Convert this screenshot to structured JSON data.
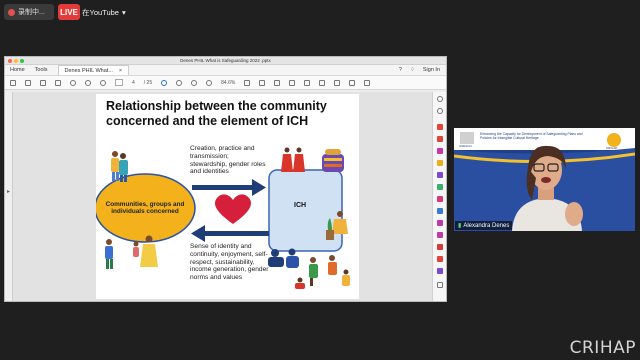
{
  "meeting": {
    "recording_label": "录制中...",
    "live_badge": "LIVE",
    "stream_target": "在YouTube",
    "stream_dropdown_icon": "chevron-down-icon"
  },
  "acrobat": {
    "window_title": "Denes PHIL What is Safeguarding 2022 .pptx",
    "tabs": {
      "home": "Home",
      "tools": "Tools",
      "document": "Denes PHIL What..."
    },
    "sign_in": "Sign In",
    "page_current": "4",
    "page_total": "/ 25",
    "zoom": "84.6%"
  },
  "slide": {
    "title": "Relationship between the community concerned and the element of ICH",
    "communities_label": "Communities, groups and individuals concerned",
    "ich_label": "ICH",
    "arrow_right_text": "Creation, practice and transmission; stewardship, gender roles and identities",
    "arrow_left_text": "Sense of identity and continuity, enjoyment, self-respect, sustainability, income generation, gender norms and values",
    "colors": {
      "ellipse": "#f3b21b",
      "ellipse_border": "#2a52a6",
      "arrow": "#1f3e78",
      "heart": "#d61f3a",
      "ich_box": "#cfe1f3"
    }
  },
  "video": {
    "participant_name": "Alexandra Denes",
    "banner_text": "Enhancing the Capacity for Development of Safeguarding Plans and Policies for Intangible Cultural Heritage",
    "org_label": "CRIHAP",
    "unesco_label": "UNESCO"
  },
  "watermark": "CRIHAP"
}
